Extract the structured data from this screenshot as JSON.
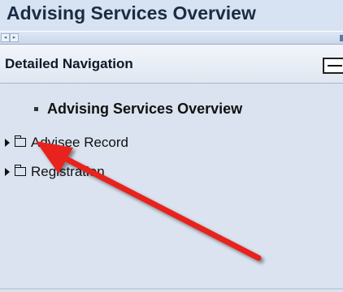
{
  "page": {
    "title": "Advising Services Overview"
  },
  "scrollbar": {
    "left_arrow": "◂",
    "right_arrow": "▸"
  },
  "navigation": {
    "header_label": "Detailed Navigation",
    "items": [
      {
        "label": "Advising Services Overview",
        "current": true
      },
      {
        "label": "Advisee Record",
        "type": "folder",
        "expanded": false
      },
      {
        "label": "Registration",
        "type": "folder",
        "expanded": false
      }
    ]
  },
  "annotation": {
    "icon": "red-arrow",
    "color": "#e8201c"
  },
  "colors": {
    "title_bar": "#d7e3f2",
    "nav_body": "#dae3ef",
    "header_bg": "#e0e7f1"
  }
}
